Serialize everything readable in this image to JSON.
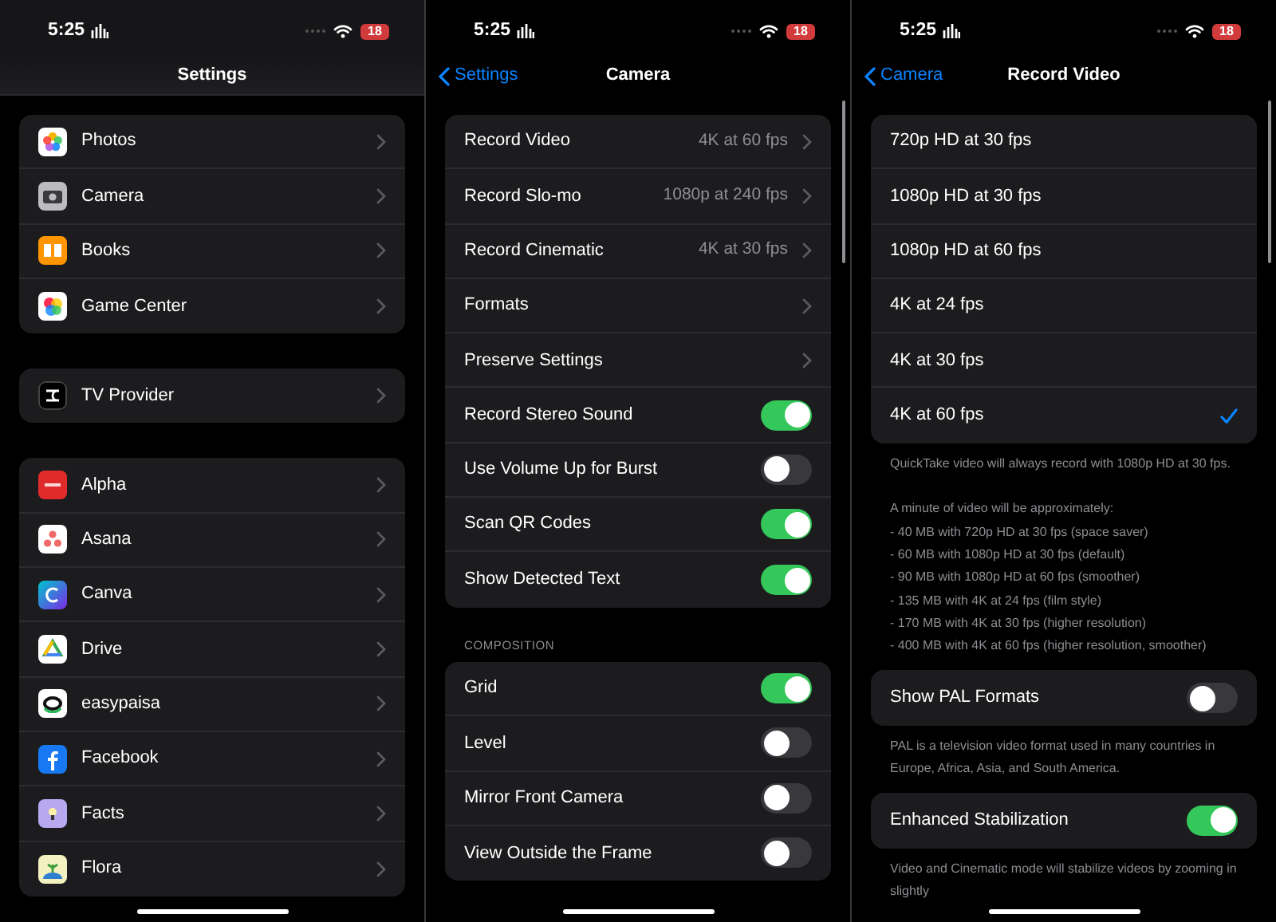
{
  "panels": [
    {
      "status_bar": {
        "time": "5:25",
        "battery": "18"
      },
      "nav": {
        "title": "Settings",
        "scrolled": true
      },
      "groups": [
        {
          "rows": [
            {
              "kind": "link",
              "label": "Photos"
            },
            {
              "kind": "link",
              "label": "Camera"
            },
            {
              "kind": "link",
              "label": "Books"
            },
            {
              "kind": "link",
              "label": "Game Center"
            }
          ]
        },
        {
          "rows": [
            {
              "kind": "link",
              "label": "TV Provider"
            }
          ]
        },
        {
          "rows": [
            {
              "kind": "link",
              "label": "Alpha"
            },
            {
              "kind": "link",
              "label": "Asana"
            },
            {
              "kind": "link",
              "label": "Canva"
            },
            {
              "kind": "link",
              "label": "Drive"
            },
            {
              "kind": "link",
              "label": "easypaisa"
            },
            {
              "kind": "link",
              "label": "Facebook"
            },
            {
              "kind": "link",
              "label": "Facts"
            },
            {
              "kind": "link",
              "label": "Flora"
            }
          ]
        }
      ]
    },
    {
      "status_bar": {
        "time": "5:25",
        "battery": "18"
      },
      "nav": {
        "back": "Settings",
        "title": "Camera",
        "scrolled": false
      },
      "groups": [
        {
          "rows": [
            {
              "kind": "link",
              "label": "Record Video",
              "value": "4K at 60 fps"
            },
            {
              "kind": "link",
              "label": "Record Slo-mo",
              "value": "1080p at 240 fps"
            },
            {
              "kind": "link",
              "label": "Record Cinematic",
              "value": "4K at 30 fps"
            },
            {
              "kind": "link",
              "label": "Formats"
            },
            {
              "kind": "link",
              "label": "Preserve Settings"
            },
            {
              "kind": "toggle",
              "label": "Record Stereo Sound",
              "on": true
            },
            {
              "kind": "toggle",
              "label": "Use Volume Up for Burst",
              "on": false
            },
            {
              "kind": "toggle",
              "label": "Scan QR Codes",
              "on": true
            },
            {
              "kind": "toggle",
              "label": "Show Detected Text",
              "on": true
            }
          ]
        },
        {
          "header": "COMPOSITION",
          "rows": [
            {
              "kind": "toggle",
              "label": "Grid",
              "on": true
            },
            {
              "kind": "toggle",
              "label": "Level",
              "on": false
            },
            {
              "kind": "toggle",
              "label": "Mirror Front Camera",
              "on": false
            },
            {
              "kind": "toggle",
              "label": "View Outside the Frame",
              "on": false
            }
          ]
        }
      ]
    },
    {
      "status_bar": {
        "time": "5:25",
        "battery": "18"
      },
      "nav": {
        "back": "Camera",
        "title": "Record Video",
        "scrolled": false
      },
      "groups": [
        {
          "rows": [
            {
              "kind": "option",
              "label": "720p HD at 30 fps",
              "selected": false
            },
            {
              "kind": "option",
              "label": "1080p HD at 30 fps",
              "selected": false
            },
            {
              "kind": "option",
              "label": "1080p HD at 60 fps",
              "selected": false
            },
            {
              "kind": "option",
              "label": "4K at 24 fps",
              "selected": false
            },
            {
              "kind": "option",
              "label": "4K at 30 fps",
              "selected": false
            },
            {
              "kind": "option",
              "label": "4K at 60 fps",
              "selected": true
            }
          ],
          "footer": [
            [
              "QuickTake video will always record with 1080p HD at 30 fps."
            ],
            [
              "A minute of video will be approximately:",
              "- 40 MB with 720p HD at 30 fps (space saver)",
              "- 60 MB with 1080p HD at 30 fps (default)",
              "- 90 MB with 1080p HD at 60 fps (smoother)",
              "- 135 MB with 4K at 24 fps (film style)",
              "- 170 MB with 4K at 30 fps (higher resolution)",
              "- 400 MB with 4K at 60 fps (higher resolution, smoother)"
            ]
          ]
        },
        {
          "rows": [
            {
              "kind": "toggle",
              "label": "Show PAL Formats",
              "on": false
            }
          ],
          "footer": [
            [
              "PAL is a television video format used in many countries in Europe, Africa, Asia, and South America."
            ]
          ]
        },
        {
          "rows": [
            {
              "kind": "toggle",
              "label": "Enhanced Stabilization",
              "on": true
            }
          ],
          "footer": [
            [
              "Video and Cinematic mode will stabilize videos by zooming in slightly"
            ]
          ]
        }
      ]
    }
  ]
}
